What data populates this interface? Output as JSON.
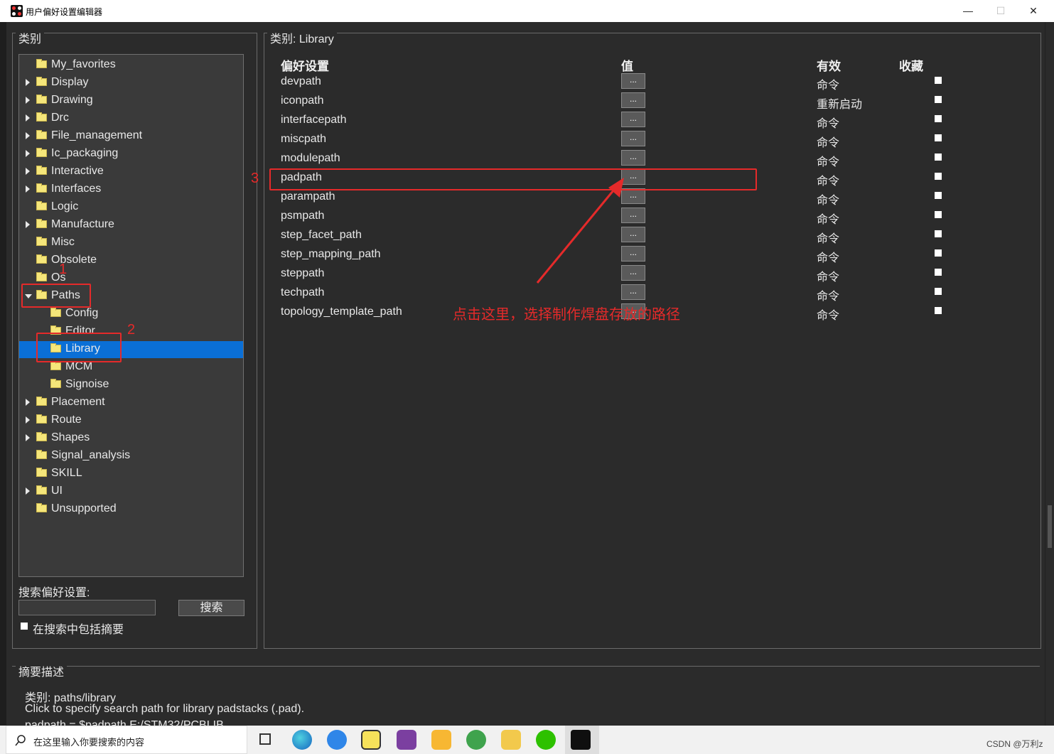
{
  "window": {
    "title": "用户偏好设置编辑器",
    "controls": {
      "minimize": "—",
      "maximize": "☐",
      "close": "✕"
    }
  },
  "left_panel": {
    "title": "类别",
    "tree": [
      {
        "label": "My_favorites",
        "level": 0,
        "expander": "none"
      },
      {
        "label": "Display",
        "level": 0,
        "expander": "closed"
      },
      {
        "label": "Drawing",
        "level": 0,
        "expander": "closed"
      },
      {
        "label": "Drc",
        "level": 0,
        "expander": "closed"
      },
      {
        "label": "File_management",
        "level": 0,
        "expander": "closed"
      },
      {
        "label": "Ic_packaging",
        "level": 0,
        "expander": "closed"
      },
      {
        "label": "Interactive",
        "level": 0,
        "expander": "closed"
      },
      {
        "label": "Interfaces",
        "level": 0,
        "expander": "closed"
      },
      {
        "label": "Logic",
        "level": 0,
        "expander": "none"
      },
      {
        "label": "Manufacture",
        "level": 0,
        "expander": "closed"
      },
      {
        "label": "Misc",
        "level": 0,
        "expander": "none"
      },
      {
        "label": "Obsolete",
        "level": 0,
        "expander": "none"
      },
      {
        "label": "Os",
        "level": 0,
        "expander": "none"
      },
      {
        "label": "Paths",
        "level": 0,
        "expander": "open"
      },
      {
        "label": "Config",
        "level": 1,
        "expander": "none"
      },
      {
        "label": "Editor",
        "level": 1,
        "expander": "none"
      },
      {
        "label": "Library",
        "level": 1,
        "expander": "none",
        "selected": true
      },
      {
        "label": "MCM",
        "level": 1,
        "expander": "none"
      },
      {
        "label": "Signoise",
        "level": 1,
        "expander": "none"
      },
      {
        "label": "Placement",
        "level": 0,
        "expander": "closed"
      },
      {
        "label": "Route",
        "level": 0,
        "expander": "closed"
      },
      {
        "label": "Shapes",
        "level": 0,
        "expander": "closed"
      },
      {
        "label": "Signal_analysis",
        "level": 0,
        "expander": "none"
      },
      {
        "label": "SKILL",
        "level": 0,
        "expander": "none"
      },
      {
        "label": "UI",
        "level": 0,
        "expander": "closed"
      },
      {
        "label": "Unsupported",
        "level": 0,
        "expander": "none"
      }
    ],
    "search_label": "搜索偏好设置:",
    "search_value": "",
    "search_button": "搜索",
    "include_summary": "在搜索中包括摘要"
  },
  "right_panel": {
    "title": "类别:  Library",
    "headers": {
      "pref": "偏好设置",
      "value": "值",
      "effective": "有效",
      "favorite": "收藏"
    },
    "button_label": "...",
    "rows": [
      {
        "name": "devpath",
        "effective": "命令"
      },
      {
        "name": "iconpath",
        "effective": "重新启动"
      },
      {
        "name": "interfacepath",
        "effective": "命令"
      },
      {
        "name": "miscpath",
        "effective": "命令"
      },
      {
        "name": "modulepath",
        "effective": "命令"
      },
      {
        "name": "padpath",
        "effective": "命令"
      },
      {
        "name": "parampath",
        "effective": "命令"
      },
      {
        "name": "psmpath",
        "effective": "命令"
      },
      {
        "name": "step_facet_path",
        "effective": "命令"
      },
      {
        "name": "step_mapping_path",
        "effective": "命令"
      },
      {
        "name": "steppath",
        "effective": "命令"
      },
      {
        "name": "techpath",
        "effective": "命令"
      },
      {
        "name": "topology_template_path",
        "effective": "命令"
      }
    ]
  },
  "annotations": {
    "num1": "1",
    "num2": "2",
    "num3": "3",
    "note": "点击这里，选择制作焊盘存放的路径",
    "color": "#e52a2a"
  },
  "summary": {
    "title": "摘要描述",
    "line1": "类别: paths/library",
    "line2": "Click to specify search path for library padstacks (.pad).",
    "line3": "padpath = $padpath E:/STM32/PCBLIB"
  },
  "taskbar": {
    "search_placeholder": "在这里输入你要搜索的内容",
    "watermark": "CSDN @万利z"
  }
}
